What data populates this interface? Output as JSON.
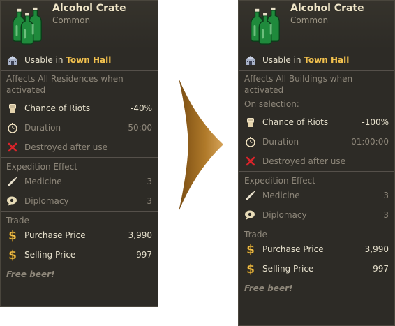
{
  "cards": {
    "left": {
      "title": "Alcohol Crate",
      "rarity": "Common",
      "usable_prefix": "Usable in",
      "usable_place": "Town Hall",
      "affects": "Affects All Residences when activated",
      "chance_label": "Chance of Riots",
      "chance_value": "-40%",
      "duration_label": "Duration",
      "duration_value": "50:00",
      "destroyed_label": "Destroyed after use",
      "expedition_title": "Expedition Effect",
      "medicine_label": "Medicine",
      "medicine_value": "3",
      "diplomacy_label": "Diplomacy",
      "diplomacy_value": "3",
      "trade_title": "Trade",
      "purchase_label": "Purchase Price",
      "purchase_value": "3,990",
      "selling_label": "Selling Price",
      "selling_value": "997",
      "flavor": "Free beer!"
    },
    "right": {
      "title": "Alcohol Crate",
      "rarity": "Common",
      "usable_prefix": "Usable in",
      "usable_place": "Town Hall",
      "affects": "Affects All Buildings when activated",
      "on_selection": "On selection:",
      "chance_label": "Chance of Riots",
      "chance_value": "-100%",
      "duration_label": "Duration",
      "duration_value": "01:00:00",
      "destroyed_label": "Destroyed after use",
      "expedition_title": "Expedition Effect",
      "medicine_label": "Medicine",
      "medicine_value": "3",
      "diplomacy_label": "Diplomacy",
      "diplomacy_value": "3",
      "trade_title": "Trade",
      "purchase_label": "Purchase Price",
      "purchase_value": "3,990",
      "selling_label": "Selling Price",
      "selling_value": "997",
      "flavor": "Free beer!"
    }
  },
  "icons": {
    "item": "green-bottles-icon",
    "building": "town-hall-icon",
    "chance": "fist-icon",
    "duration": "stopwatch-icon",
    "destroyed": "red-x-icon",
    "medicine": "syringe-icon",
    "diplomacy": "speech-bubble-icon",
    "money": "dollar-icon",
    "transition": "arrow-right-icon"
  },
  "colors": {
    "panel": "#2d2b26",
    "highlight": "#f2c14e",
    "dim_text": "#8e877a",
    "text": "#e6e0cc",
    "arrow": "#b07a2a"
  }
}
